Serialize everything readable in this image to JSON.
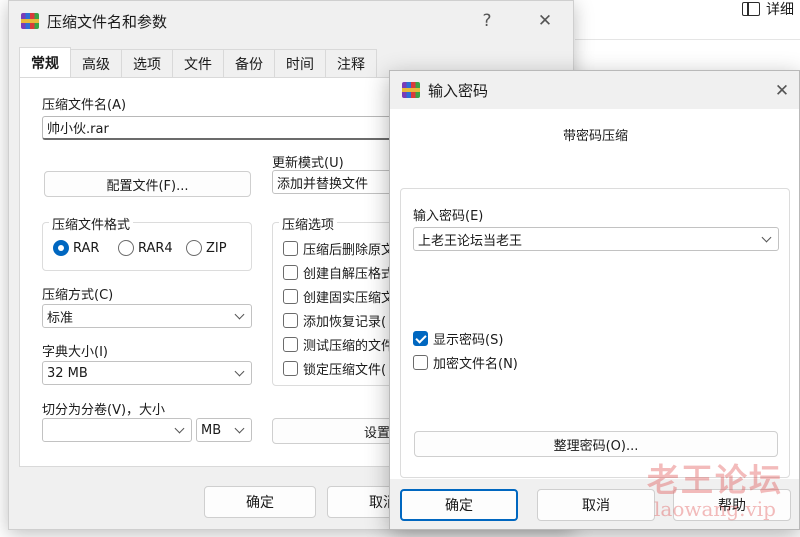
{
  "background_window": {
    "details_label": "详细",
    "panel_icon": "details-pane-icon"
  },
  "main_dialog": {
    "title": "压缩文件名和参数",
    "help_glyph": "?",
    "close_glyph": "✕",
    "tabs": [
      "常规",
      "高级",
      "选项",
      "文件",
      "备份",
      "时间",
      "注释"
    ],
    "active_tab": "常规",
    "archive_name_label": "压缩文件名(A)",
    "archive_name_value": "帅小伙.rar",
    "update_mode_label": "更新模式(U)",
    "update_mode_value": "添加并替换文件",
    "profiles_button": "配置文件(F)...",
    "format_group": {
      "title": "压缩文件格式",
      "options": [
        "RAR",
        "RAR4",
        "ZIP"
      ],
      "selected": "RAR"
    },
    "options_group": {
      "title": "压缩选项",
      "items": [
        {
          "label": "压缩后删除原文",
          "checked": false
        },
        {
          "label": "创建自解压格式",
          "checked": false
        },
        {
          "label": "创建固实压缩文",
          "checked": false
        },
        {
          "label": "添加恢复记录(",
          "checked": false
        },
        {
          "label": "测试压缩的文件",
          "checked": false
        },
        {
          "label": "锁定压缩文件(",
          "checked": false
        }
      ]
    },
    "method_label": "压缩方式(C)",
    "method_value": "标准",
    "dict_label": "字典大小(I)",
    "dict_value": "32 MB",
    "split_label": "切分为分卷(V)，大小",
    "split_value": "",
    "split_unit": "MB",
    "set_password_button": "设置",
    "ok_button": "确定",
    "cancel_button": "取消"
  },
  "password_dialog": {
    "title": "输入密码",
    "close_glyph": "✕",
    "heading": "带密码压缩",
    "password_label": "输入密码(E)",
    "password_value": "上老王论坛当老王",
    "show_password_label": "显示密码(S)",
    "show_password_checked": true,
    "encrypt_names_label": "加密文件名(N)",
    "encrypt_names_checked": false,
    "organize_button": "整理密码(O)...",
    "ok_button": "确定",
    "cancel_button": "取消",
    "help_button": "帮助"
  },
  "watermark": {
    "title": "老王论坛",
    "url": "laowang.vip"
  },
  "colors": {
    "accent": "#0067c0",
    "dialog_bg": "#f0f0f0",
    "watermark": "#dc3c3c"
  }
}
